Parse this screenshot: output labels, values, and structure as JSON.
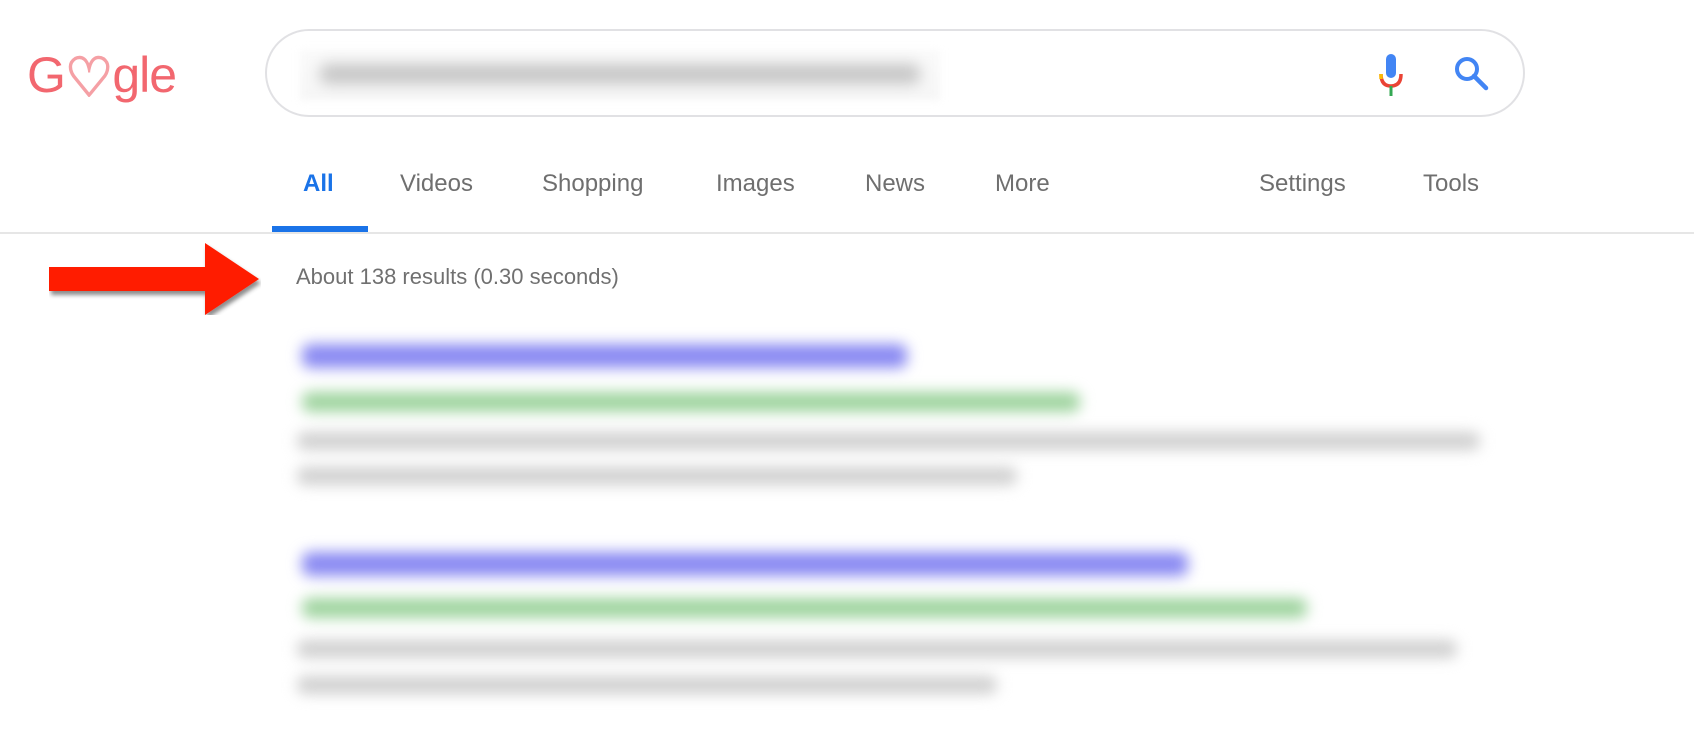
{
  "logo": {
    "text_before": "G",
    "heart": "♡",
    "text_after": "gle"
  },
  "search": {
    "query": "",
    "mic_icon": "microphone-icon",
    "search_icon": "search-icon"
  },
  "tabs": [
    {
      "label": "All",
      "active": true
    },
    {
      "label": "Videos"
    },
    {
      "label": "Shopping"
    },
    {
      "label": "Images"
    },
    {
      "label": "News"
    },
    {
      "label": "More"
    }
  ],
  "tools": {
    "settings": "Settings",
    "tools": "Tools"
  },
  "result_stats": "About 138 results (0.30 seconds)",
  "colors": {
    "accent": "#1a73e8",
    "arrow": "#ff1a00",
    "logo": "#f2676f",
    "link_blur": "#7f7ff0",
    "url_blur": "#8fcf8f"
  }
}
